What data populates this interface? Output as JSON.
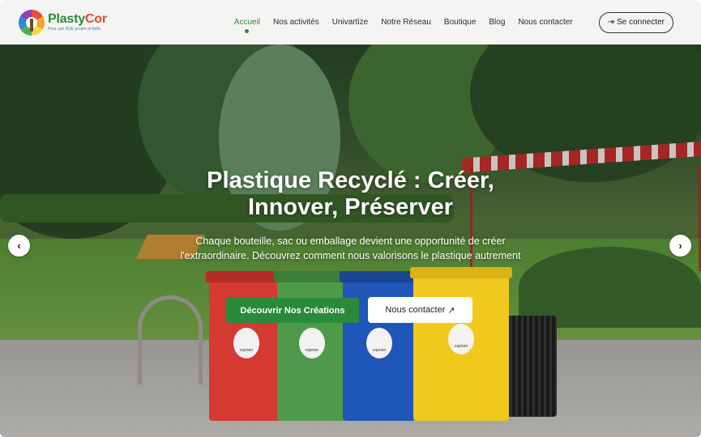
{
  "brand": {
    "name_part1": "Plasty",
    "name_part2": "Cor",
    "tagline": "Pour une RSE propre et belle"
  },
  "nav": {
    "items": [
      {
        "label": "Accueil",
        "active": true
      },
      {
        "label": "Nos activités",
        "active": false
      },
      {
        "label": "Univartize",
        "active": false
      },
      {
        "label": "Notre Réseau",
        "active": false
      },
      {
        "label": "Boutique",
        "active": false
      },
      {
        "label": "Blog",
        "active": false
      },
      {
        "label": "Nous contacter",
        "active": false
      }
    ],
    "login_label": "Se connecter",
    "login_icon": "login-icon"
  },
  "hero": {
    "title_line1": "Plastique Recyclé : Créer,",
    "title_line2": "Innover, Préserver",
    "subtitle": "Chaque bouteille, sac ou emballage devient une opportunité de créer l'extraordinaire. Découvrez comment nous valorisons le plastique autrement",
    "primary_cta": "Découvrir Nos Créations",
    "secondary_cta": "Nous contacter",
    "secondary_cta_icon": "arrow-up-right-icon",
    "prev_icon": "chevron-left-icon",
    "next_icon": "chevron-right-icon",
    "bin_label": "харпия"
  },
  "colors": {
    "primary_green": "#2a8a3c",
    "brand_red": "#e2492f"
  }
}
